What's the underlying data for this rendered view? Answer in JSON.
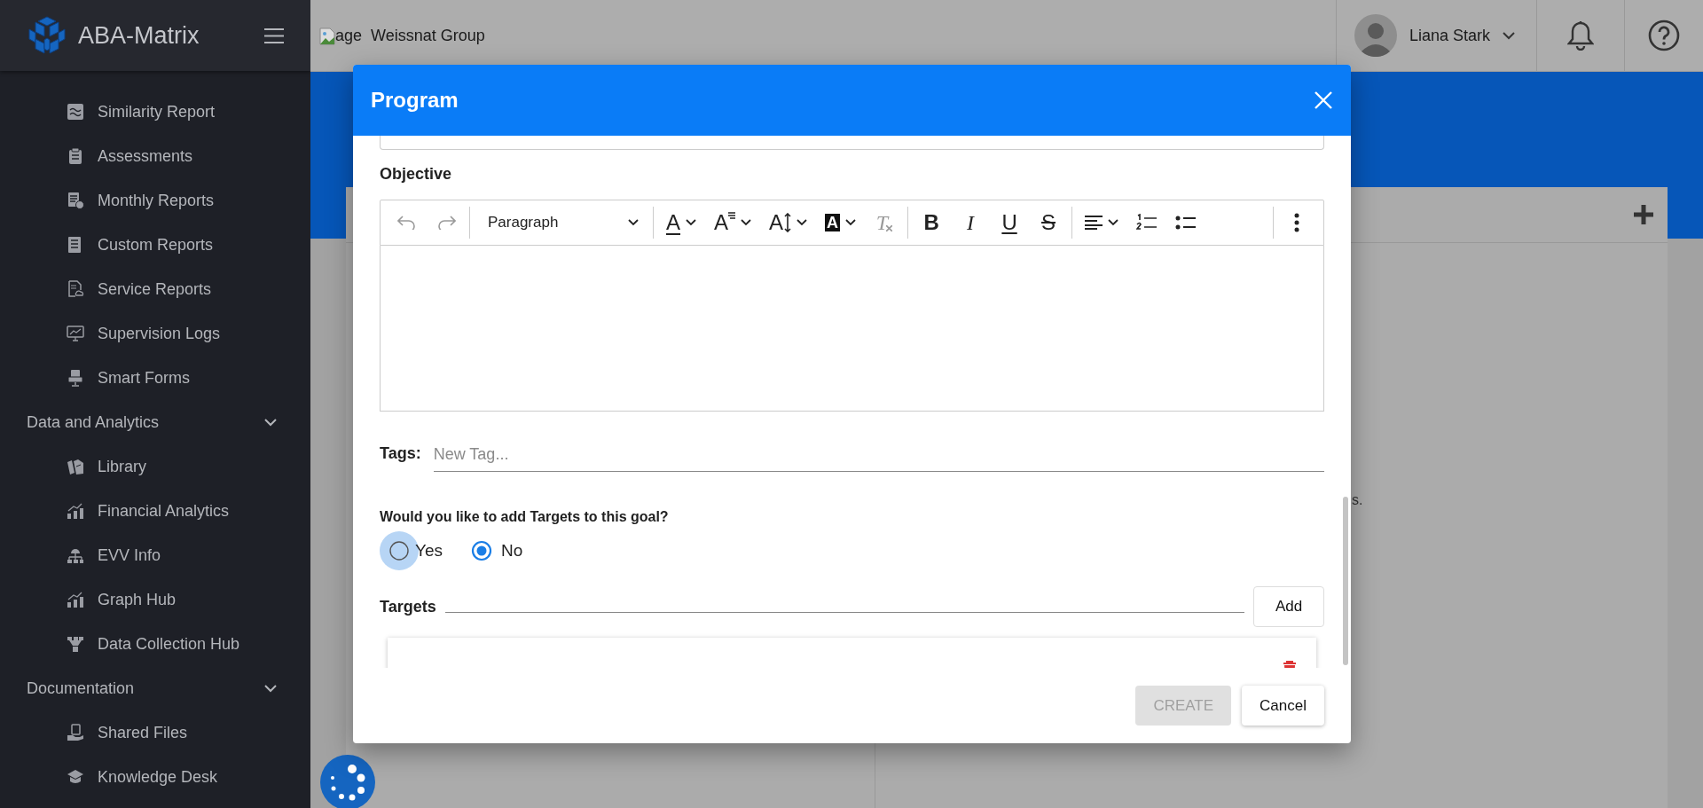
{
  "sidebar": {
    "brand": "ABA-Matrix",
    "items": [
      {
        "label": "Similarity Report"
      },
      {
        "label": "Assessments"
      },
      {
        "label": "Monthly Reports"
      },
      {
        "label": "Custom Reports"
      },
      {
        "label": "Service Reports"
      },
      {
        "label": "Supervision Logs"
      },
      {
        "label": "Smart Forms"
      },
      {
        "label": "Data and Analytics",
        "expanded": true,
        "children": [
          {
            "label": "Library"
          },
          {
            "label": "Financial Analytics"
          },
          {
            "label": "EVV Info"
          },
          {
            "label": "Graph Hub"
          },
          {
            "label": "Data Collection Hub"
          }
        ]
      },
      {
        "label": "Documentation",
        "expanded": true,
        "children": [
          {
            "label": "Shared Files"
          },
          {
            "label": "Knowledge Desk"
          }
        ]
      }
    ]
  },
  "topbar": {
    "image_alt": "age",
    "organization": "Weissnat Group",
    "user": "Liana Stark"
  },
  "background_text": "s.",
  "dialog": {
    "title": "Program",
    "objective_label": "Objective",
    "toolbar": [
      [
        {
          "kind": "undo",
          "disabled": true
        },
        {
          "kind": "redo",
          "disabled": true
        }
      ],
      [
        {
          "kind": "block-style",
          "label": "Paragraph",
          "caret": true,
          "disabled": false
        }
      ],
      [
        {
          "kind": "font-color",
          "glyph": "A",
          "caret": true,
          "disabled": false
        },
        {
          "kind": "font-family",
          "glyph": "A",
          "caret": true,
          "disabled": false
        },
        {
          "kind": "font-size",
          "glyph": "A",
          "caret": true,
          "disabled": false
        },
        {
          "kind": "highlight",
          "glyph": "A",
          "caret": true,
          "disabled": false
        },
        {
          "kind": "clear-format",
          "glyph": "T",
          "caret": false,
          "disabled": true
        }
      ],
      [
        {
          "kind": "bold",
          "glyph": "B",
          "disabled": false
        },
        {
          "kind": "italic",
          "glyph": "I",
          "disabled": false
        },
        {
          "kind": "underline",
          "glyph": "U",
          "disabled": false
        },
        {
          "kind": "strike",
          "glyph": "S",
          "disabled": false
        }
      ],
      [
        {
          "kind": "align",
          "caret": true,
          "disabled": false
        },
        {
          "kind": "numbered-list",
          "disabled": false
        },
        {
          "kind": "bulleted-list",
          "disabled": false
        }
      ],
      [
        {
          "kind": "more",
          "disabled": false
        }
      ]
    ],
    "tags_label": "Tags:",
    "tags_placeholder": "New Tag...",
    "question": "Would you like to add Targets to this goal?",
    "options": [
      {
        "label": "Yes",
        "selected": false,
        "focused": true
      },
      {
        "label": "No",
        "selected": true,
        "focused": false
      }
    ],
    "targets_label": "Targets",
    "add_button": "Add",
    "buttons": [
      {
        "label": "CREATE",
        "disabled": true
      },
      {
        "label": "Cancel",
        "disabled": false
      }
    ]
  }
}
